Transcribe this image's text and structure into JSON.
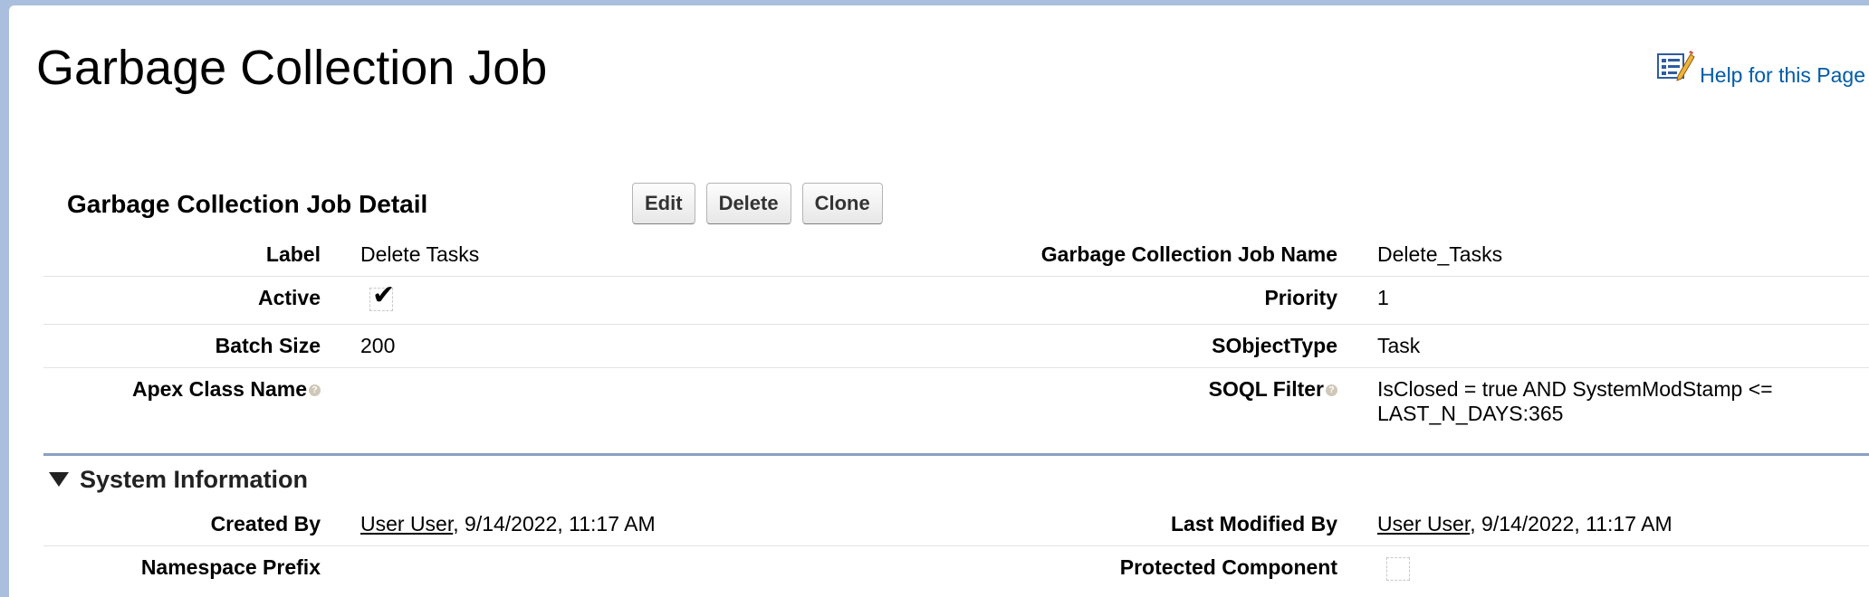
{
  "page": {
    "title": "Garbage Collection Job",
    "help_label": "Help for this Page"
  },
  "detail": {
    "title": "Garbage Collection Job Detail",
    "buttons": {
      "edit": "Edit",
      "delete": "Delete",
      "clone": "Clone"
    },
    "fields": {
      "label": {
        "name": "Label",
        "value": "Delete Tasks"
      },
      "job_name": {
        "name": "Garbage Collection Job Name",
        "value": "Delete_Tasks"
      },
      "active": {
        "name": "Active",
        "checked": true,
        "mark": "✔"
      },
      "priority": {
        "name": "Priority",
        "value": "1"
      },
      "batch_size": {
        "name": "Batch Size",
        "value": "200"
      },
      "sobject_type": {
        "name": "SObjectType",
        "value": "Task"
      },
      "apex_class": {
        "name": "Apex Class Name",
        "value": ""
      },
      "soql_filter": {
        "name": "SOQL Filter",
        "value": "IsClosed = true AND SystemModStamp <= LAST_N_DAYS:365"
      }
    }
  },
  "system_info": {
    "title": "System Information",
    "created_by": {
      "name": "Created By",
      "user": "User User",
      "stamp": ", 9/14/2022, 11:17 AM"
    },
    "last_modified_by": {
      "name": "Last Modified By",
      "user": "User User",
      "stamp": ", 9/14/2022, 11:17 AM"
    },
    "namespace_prefix": {
      "name": "Namespace Prefix",
      "value": ""
    },
    "protected_component": {
      "name": "Protected Component",
      "checked": false
    }
  },
  "icons": {
    "help": "help-book-pencil-icon",
    "info": "info-icon",
    "collapse": "triangle-down-icon",
    "checkbox": "checkbox-icon"
  },
  "colors": {
    "link": "#015ba7",
    "section_rule": "#8aa0c4",
    "background": "#a9bfdd"
  }
}
